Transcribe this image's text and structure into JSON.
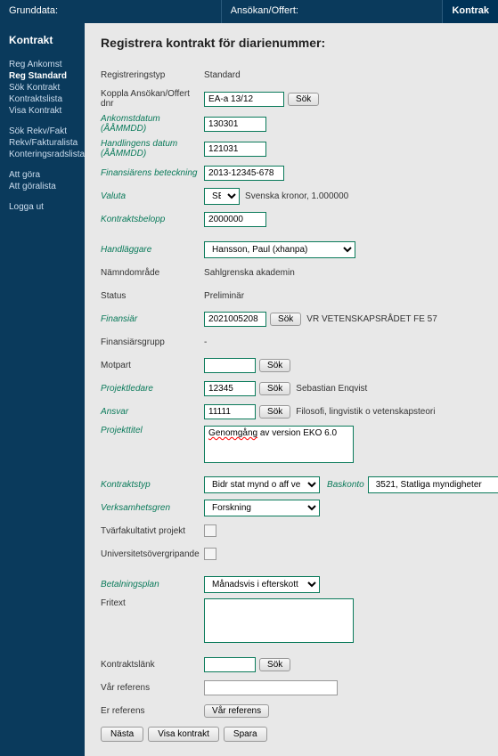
{
  "topbar": {
    "grunddata": "Grunddata:",
    "ansokan": "Ansökan/Offert:",
    "kontrakt": "Kontrak"
  },
  "sidebar": {
    "title": "Kontrakt",
    "g1": [
      "Reg Ankomst",
      "Reg Standard",
      "Sök Kontrakt",
      "Kontraktslista",
      "Visa Kontrakt"
    ],
    "g2": [
      "Sök Rekv/Fakt",
      "Rekv/Fakturalista",
      "Konteringsradslista"
    ],
    "g3": [
      "Att göra",
      "Att göralista"
    ],
    "g4": [
      "Logga ut"
    ]
  },
  "heading": "Registrera kontrakt för diarienummer:",
  "labels": {
    "regtyp": "Registreringstyp",
    "koppla": "Koppla Ansökan/Offert dnr",
    "ankomst": "Ankomstdatum (ÅÅMMDD)",
    "handling": "Handlingens datum (ÅÅMMDD)",
    "finbet": "Finansiärens beteckning",
    "valuta": "Valuta",
    "belopp": "Kontraktsbelopp",
    "handlaggare": "Handläggare",
    "namnd": "Nämndområde",
    "status": "Status",
    "finansiar": "Finansiär",
    "fingrupp": "Finansiärsgrupp",
    "motpart": "Motpart",
    "projledare": "Projektledare",
    "ansvar": "Ansvar",
    "projtitel": "Projekttitel",
    "kontraktstyp": "Kontraktstyp",
    "baskonto": "Baskonto",
    "verksamhet": "Verksamhetsgren",
    "tvar": "Tvärfakultativt projekt",
    "univ": "Universitetsövergripande",
    "betplan": "Betalningsplan",
    "fritext": "Fritext",
    "klank": "Kontraktslänk",
    "varref": "Vår referens",
    "erref": "Er referens"
  },
  "values": {
    "regtyp": "Standard",
    "koppla": "EA-a 13/12",
    "ankomst": "130301",
    "handling": "121031",
    "finbet": "2013-12345-678",
    "valuta": "SEK",
    "valuta_after": "Svenska kronor, 1.000000",
    "belopp": "2000000",
    "handlaggare": "Hansson, Paul (xhanpa)",
    "namnd": "Sahlgrenska akademin",
    "status": "Preliminär",
    "finansiar": "2021005208",
    "finansiar_after": "VR VETENSKAPSRÅDET FE 57",
    "fingrupp": "-",
    "motpart": "",
    "projledare": "12345",
    "projledare_after": "Sebastian Enqvist",
    "ansvar": "11111",
    "ansvar_after": "Filosofi, lingvistik o vetenskapsteori",
    "projtitel_err": "Genomgång",
    "projtitel_rest": " av version EKO 6.0",
    "kontraktstyp": "Bidr stat mynd o aff verk",
    "baskonto": "3521, Statliga myndigheter",
    "verksamhet": "Forskning",
    "betplan": "Månadsvis i efterskott",
    "fritext": "",
    "klank": "",
    "varref": "",
    "erref": ""
  },
  "buttons": {
    "sok": "Sök",
    "varref": "Vår referens",
    "nasta": "Nästa",
    "visa": "Visa kontrakt",
    "spara": "Spara"
  }
}
